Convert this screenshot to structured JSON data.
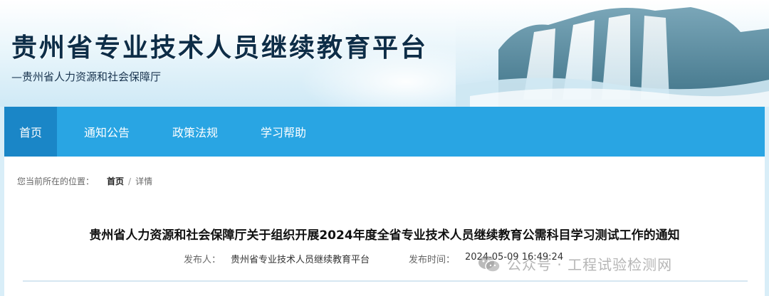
{
  "header": {
    "title": "贵州省专业技术人员继续教育平台",
    "subtitle": "—贵州省人力资源和社会保障厅"
  },
  "nav": {
    "items": [
      {
        "label": "首页",
        "active": true
      },
      {
        "label": "通知公告",
        "active": false
      },
      {
        "label": "政策法规",
        "active": false
      },
      {
        "label": "学习帮助",
        "active": false
      }
    ]
  },
  "breadcrumb": {
    "prefix": "您当前所在的位置：",
    "home": "首页",
    "separator": "/",
    "current": "详情"
  },
  "article": {
    "title": "贵州省人力资源和社会保障厅关于组织开展2024年度全省专业技术人员继续教育公需科目学习测试工作的通知",
    "publisher_label": "发布人：",
    "publisher": "贵州省专业技术人员继续教育平台",
    "time_label": "发布时间：",
    "time": "2024-05-09 16:49:24"
  },
  "watermark": {
    "text": "公众号 · 工程试验检测网",
    "icon": "wechat-icon"
  },
  "colors": {
    "nav_bg": "#29a5e3",
    "nav_active": "#1a86c7",
    "title_color": "#0d2d47"
  }
}
